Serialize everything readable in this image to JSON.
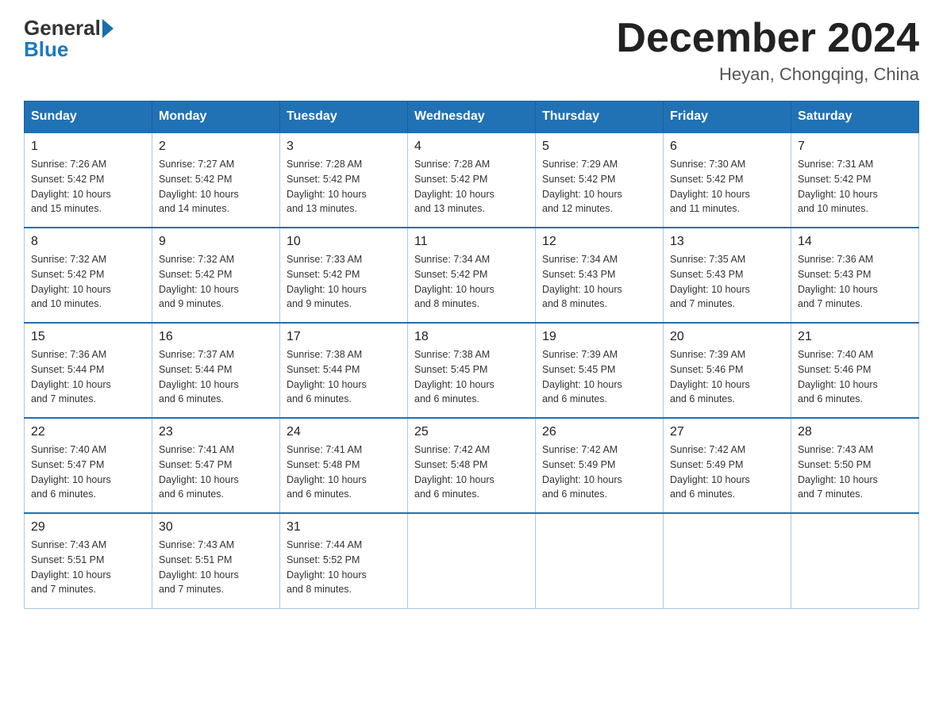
{
  "header": {
    "logo_general": "General",
    "logo_blue": "Blue",
    "month_title": "December 2024",
    "location": "Heyan, Chongqing, China"
  },
  "days_of_week": [
    "Sunday",
    "Monday",
    "Tuesday",
    "Wednesday",
    "Thursday",
    "Friday",
    "Saturday"
  ],
  "weeks": [
    [
      {
        "day": "1",
        "sunrise": "7:26 AM",
        "sunset": "5:42 PM",
        "daylight": "10 hours and 15 minutes."
      },
      {
        "day": "2",
        "sunrise": "7:27 AM",
        "sunset": "5:42 PM",
        "daylight": "10 hours and 14 minutes."
      },
      {
        "day": "3",
        "sunrise": "7:28 AM",
        "sunset": "5:42 PM",
        "daylight": "10 hours and 13 minutes."
      },
      {
        "day": "4",
        "sunrise": "7:28 AM",
        "sunset": "5:42 PM",
        "daylight": "10 hours and 13 minutes."
      },
      {
        "day": "5",
        "sunrise": "7:29 AM",
        "sunset": "5:42 PM",
        "daylight": "10 hours and 12 minutes."
      },
      {
        "day": "6",
        "sunrise": "7:30 AM",
        "sunset": "5:42 PM",
        "daylight": "10 hours and 11 minutes."
      },
      {
        "day": "7",
        "sunrise": "7:31 AM",
        "sunset": "5:42 PM",
        "daylight": "10 hours and 10 minutes."
      }
    ],
    [
      {
        "day": "8",
        "sunrise": "7:32 AM",
        "sunset": "5:42 PM",
        "daylight": "10 hours and 10 minutes."
      },
      {
        "day": "9",
        "sunrise": "7:32 AM",
        "sunset": "5:42 PM",
        "daylight": "10 hours and 9 minutes."
      },
      {
        "day": "10",
        "sunrise": "7:33 AM",
        "sunset": "5:42 PM",
        "daylight": "10 hours and 9 minutes."
      },
      {
        "day": "11",
        "sunrise": "7:34 AM",
        "sunset": "5:42 PM",
        "daylight": "10 hours and 8 minutes."
      },
      {
        "day": "12",
        "sunrise": "7:34 AM",
        "sunset": "5:43 PM",
        "daylight": "10 hours and 8 minutes."
      },
      {
        "day": "13",
        "sunrise": "7:35 AM",
        "sunset": "5:43 PM",
        "daylight": "10 hours and 7 minutes."
      },
      {
        "day": "14",
        "sunrise": "7:36 AM",
        "sunset": "5:43 PM",
        "daylight": "10 hours and 7 minutes."
      }
    ],
    [
      {
        "day": "15",
        "sunrise": "7:36 AM",
        "sunset": "5:44 PM",
        "daylight": "10 hours and 7 minutes."
      },
      {
        "day": "16",
        "sunrise": "7:37 AM",
        "sunset": "5:44 PM",
        "daylight": "10 hours and 6 minutes."
      },
      {
        "day": "17",
        "sunrise": "7:38 AM",
        "sunset": "5:44 PM",
        "daylight": "10 hours and 6 minutes."
      },
      {
        "day": "18",
        "sunrise": "7:38 AM",
        "sunset": "5:45 PM",
        "daylight": "10 hours and 6 minutes."
      },
      {
        "day": "19",
        "sunrise": "7:39 AM",
        "sunset": "5:45 PM",
        "daylight": "10 hours and 6 minutes."
      },
      {
        "day": "20",
        "sunrise": "7:39 AM",
        "sunset": "5:46 PM",
        "daylight": "10 hours and 6 minutes."
      },
      {
        "day": "21",
        "sunrise": "7:40 AM",
        "sunset": "5:46 PM",
        "daylight": "10 hours and 6 minutes."
      }
    ],
    [
      {
        "day": "22",
        "sunrise": "7:40 AM",
        "sunset": "5:47 PM",
        "daylight": "10 hours and 6 minutes."
      },
      {
        "day": "23",
        "sunrise": "7:41 AM",
        "sunset": "5:47 PM",
        "daylight": "10 hours and 6 minutes."
      },
      {
        "day": "24",
        "sunrise": "7:41 AM",
        "sunset": "5:48 PM",
        "daylight": "10 hours and 6 minutes."
      },
      {
        "day": "25",
        "sunrise": "7:42 AM",
        "sunset": "5:48 PM",
        "daylight": "10 hours and 6 minutes."
      },
      {
        "day": "26",
        "sunrise": "7:42 AM",
        "sunset": "5:49 PM",
        "daylight": "10 hours and 6 minutes."
      },
      {
        "day": "27",
        "sunrise": "7:42 AM",
        "sunset": "5:49 PM",
        "daylight": "10 hours and 6 minutes."
      },
      {
        "day": "28",
        "sunrise": "7:43 AM",
        "sunset": "5:50 PM",
        "daylight": "10 hours and 7 minutes."
      }
    ],
    [
      {
        "day": "29",
        "sunrise": "7:43 AM",
        "sunset": "5:51 PM",
        "daylight": "10 hours and 7 minutes."
      },
      {
        "day": "30",
        "sunrise": "7:43 AM",
        "sunset": "5:51 PM",
        "daylight": "10 hours and 7 minutes."
      },
      {
        "day": "31",
        "sunrise": "7:44 AM",
        "sunset": "5:52 PM",
        "daylight": "10 hours and 8 minutes."
      },
      null,
      null,
      null,
      null
    ]
  ],
  "labels": {
    "sunrise": "Sunrise:",
    "sunset": "Sunset:",
    "daylight": "Daylight:"
  }
}
